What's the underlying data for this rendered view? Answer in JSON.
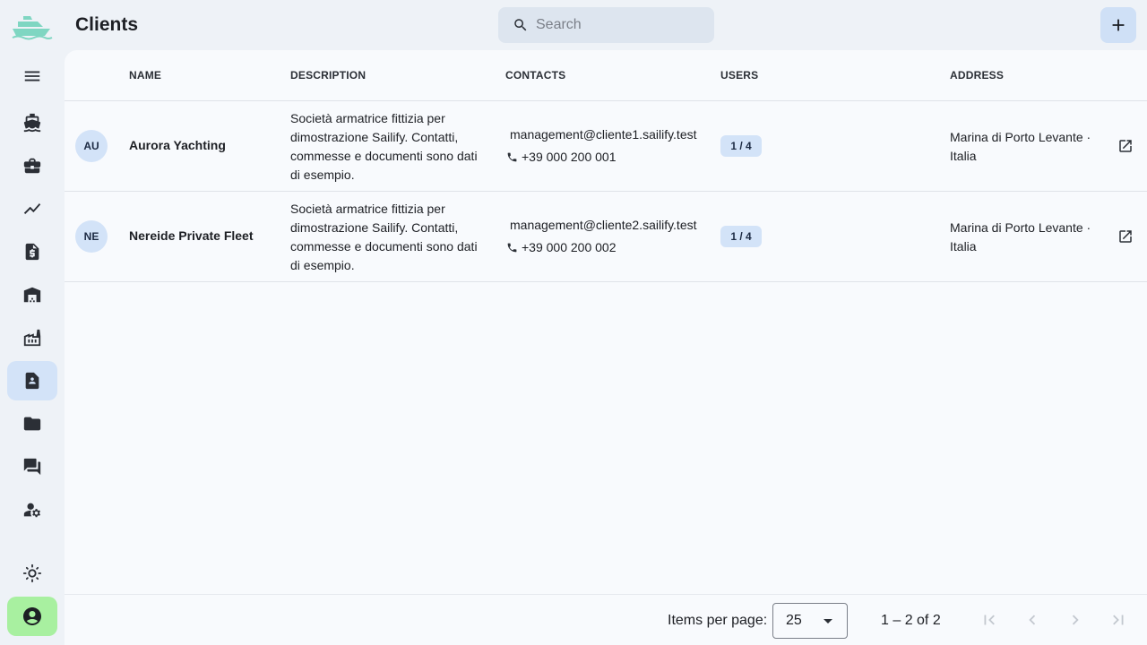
{
  "header": {
    "title": "Clients",
    "search_placeholder": "Search"
  },
  "sidebar": {
    "items": [
      {
        "icon": "menu-icon"
      },
      {
        "icon": "boat-icon"
      },
      {
        "icon": "briefcase-icon"
      },
      {
        "icon": "trending-line-icon"
      },
      {
        "icon": "invoice-dollar-icon"
      },
      {
        "icon": "warehouse-icon"
      },
      {
        "icon": "factory-icon"
      },
      {
        "icon": "contact-page-icon",
        "active": true
      },
      {
        "icon": "folder-icon"
      },
      {
        "icon": "forum-icon"
      },
      {
        "icon": "manage-accounts-icon"
      },
      {
        "icon": "light-mode-icon"
      }
    ],
    "account_icon": "account-circle-icon"
  },
  "table": {
    "columns": {
      "name": "NAME",
      "description": "DESCRIPTION",
      "contacts": "CONTACTS",
      "users": "USERS",
      "address": "ADDRESS"
    },
    "rows": [
      {
        "initials": "AU",
        "name": "Aurora Yachting",
        "description": "Società armatrice fittizia per dimostrazione Sailify. Contatti, commesse e documenti sono dati di esempio.",
        "email": "management@cliente1.sailify.test",
        "phone": "+39 000 200 001",
        "users": "1 / 4",
        "address": "Marina di Porto Levante · Italia"
      },
      {
        "initials": "NE",
        "name": "Nereide Private Fleet",
        "description": "Società armatrice fittizia per dimostrazione Sailify. Contatti, commesse e documenti sono dati di esempio.",
        "email": "management@cliente2.sailify.test",
        "phone": "+39 000 200 002",
        "users": "1 / 4",
        "address": "Marina di Porto Levante · Italia"
      }
    ]
  },
  "paginator": {
    "items_per_page_label": "Items per page:",
    "items_per_page_value": "25",
    "range_label": "1 – 2 of 2"
  },
  "colors": {
    "active_nav": "#d3e3f8",
    "account_button": "#a8f0a0",
    "logo": "#7fd6c2"
  }
}
